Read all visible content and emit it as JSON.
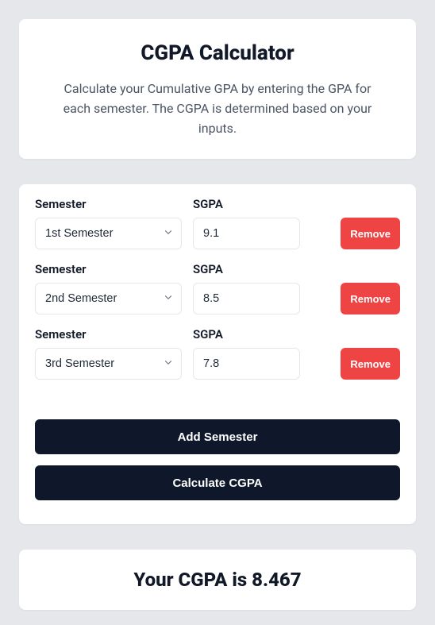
{
  "header": {
    "title": "CGPA Calculator",
    "subtitle": "Calculate your Cumulative GPA by entering the GPA for each semester. The CGPA is determined based on your inputs."
  },
  "labels": {
    "semester": "Semester",
    "sgpa": "SGPA",
    "remove": "Remove",
    "add": "Add Semester",
    "calculate": "Calculate CGPA"
  },
  "rows": [
    {
      "semester": "1st Semester",
      "sgpa": "9.1"
    },
    {
      "semester": "2nd Semester",
      "sgpa": "8.5"
    },
    {
      "semester": "3rd Semester",
      "sgpa": "7.8"
    }
  ],
  "result_text": "Your CGPA is 8.467"
}
